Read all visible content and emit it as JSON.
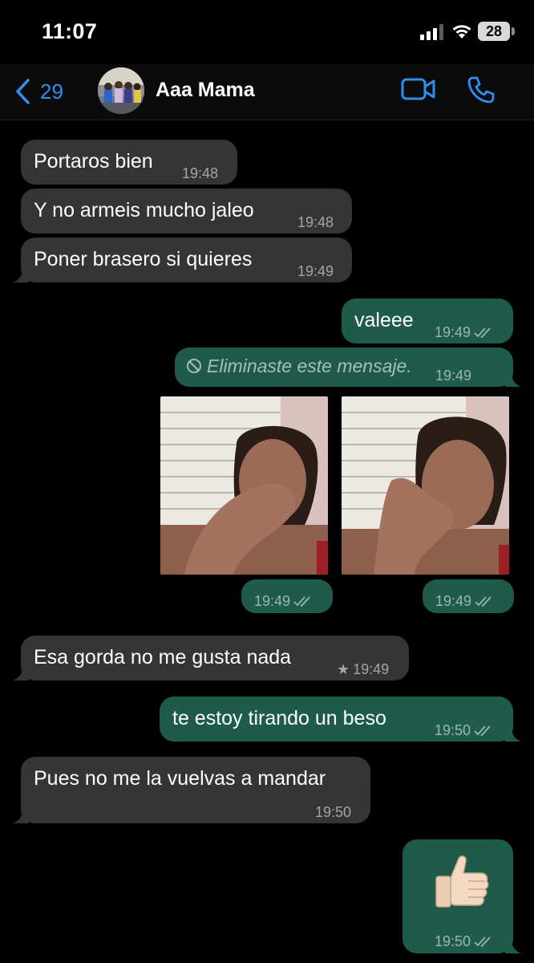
{
  "status": {
    "time": "11:07",
    "battery": "28"
  },
  "header": {
    "back_count": "29",
    "contact_name": "Aaa Mama"
  },
  "messages": [
    {
      "dir": "in",
      "text": "Portaros bien",
      "time": "19:48"
    },
    {
      "dir": "in",
      "text": "Y no armeis mucho jaleo",
      "time": "19:48"
    },
    {
      "dir": "in",
      "text": "Poner brasero si quieres",
      "time": "19:49"
    },
    {
      "dir": "out",
      "text": "valeee",
      "time": "19:49"
    },
    {
      "dir": "out",
      "text": "Eliminaste este mensaje.",
      "time": "19:49"
    },
    {
      "dir": "out",
      "type": "photo",
      "time": "19:49"
    },
    {
      "dir": "out",
      "type": "photo",
      "time": "19:49"
    },
    {
      "dir": "in",
      "text": "Esa gorda no me gusta nada",
      "time": "19:49",
      "starred": true
    },
    {
      "dir": "out",
      "text": "te estoy tirando un beso",
      "time": "19:50"
    },
    {
      "dir": "in",
      "text": "Pues no me la vuelvas a mandar",
      "time": "19:50"
    },
    {
      "dir": "out",
      "type": "emoji",
      "emoji_icon": "thumbs-up-icon",
      "time": "19:50"
    }
  ],
  "colors": {
    "incoming_bubble": "#353535",
    "outgoing_bubble": "#1f5b4b",
    "accent": "#2f8ff0"
  }
}
